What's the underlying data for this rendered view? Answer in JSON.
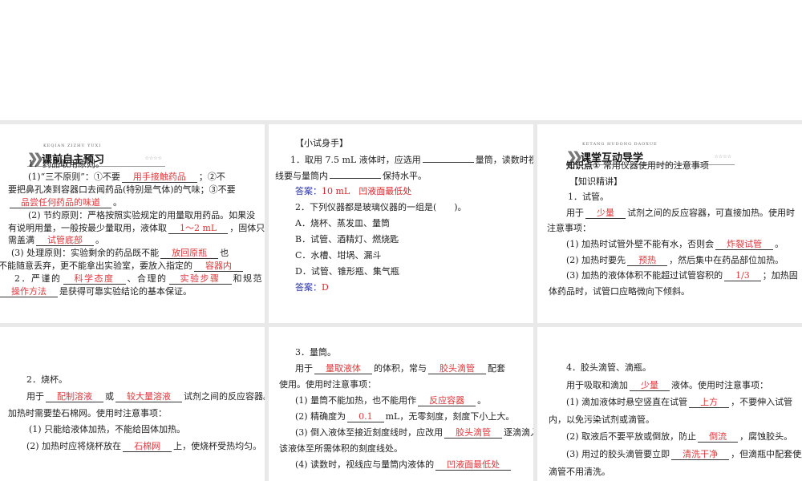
{
  "slides": [
    {
      "banner": {
        "pinyin": "KEQIAN ZIZHU YUXI",
        "title": "课前自主预习",
        "stars": "☆☆☆☆"
      },
      "lines": [
        [
          "1．药品取用原则。"
        ],
        [
          "(1)“三不原则”：①不要",
          {
            "a": "用手接触药品"
          },
          "；②不"
        ],
        [
          "要把鼻孔凑到容器口去闻药品(特别是气体)的气味；③不要"
        ],
        [
          {
            "a": "品尝任何药品的味道"
          },
          "。"
        ],
        [
          "(2) 节约原则：严格按照实验规定的用量取用药品。如果没"
        ],
        [
          "有说明用量，一般按最少量取用，液体取",
          {
            "a": "1～2 mL"
          },
          "，固体只"
        ],
        [
          "需盖满",
          {
            "a": "试管底部"
          },
          "。"
        ],
        [
          "(3) 处理原则：实验剩余的药品既不能",
          {
            "a": "放回原瓶"
          },
          "也"
        ],
        [
          "不能随意丢弃，更不能拿出实验室，要放入指定的",
          {
            "a": "容器内"
          }
        ],
        [
          "2．严谨的",
          {
            "a": "科学态度"
          },
          "、合理的",
          {
            "a": "实验步骤"
          },
          "和规范"
        ],
        [
          {
            "a": "操作方法"
          },
          "是获得可靠实验结论的基本保证。"
        ]
      ]
    },
    {
      "lines": [
        [
          "【小试身手】"
        ],
        [
          "1．取用 7.5 mL 液体时，应选用",
          {
            "b": ""
          },
          "量筒，读数时视"
        ],
        [
          "线要与量筒内",
          {
            "b": ""
          },
          "保持水平。"
        ],
        [
          {
            "l": "答案："
          },
          {
            "r": "10 mL　凹液面最低处"
          }
        ],
        [
          "2．下列仪器都是玻璃仪器的一组是(　　)。"
        ],
        [
          "A．烧杯、蒸发皿、量筒"
        ],
        [
          "B．试管、酒精灯、燃烧匙"
        ],
        [
          "C．水槽、坩埚、漏斗"
        ],
        [
          "D．试管、锥形瓶、集气瓶"
        ],
        [
          {
            "l": "答案："
          },
          {
            "r": "D"
          }
        ]
      ]
    },
    {
      "banner": {
        "pinyin": "KETANG HUDONG DAOXUE",
        "title": "课堂互动导学",
        "stars": "☆☆☆☆"
      },
      "lines": [
        [
          {
            "k": "知识点①"
          },
          " 常用仪器使用时的注意事项"
        ],
        [
          "【知识精讲】"
        ],
        [
          "1．试管。"
        ],
        [
          "用于",
          {
            "a": "少量"
          },
          "试剂之间的反应容器，可直接加热。使用时"
        ],
        [
          "注意事项："
        ],
        [
          "(1) 加热时试管外壁不能有水，否则会",
          {
            "a": "炸裂试管"
          },
          "。"
        ],
        [
          "(2) 加热时要先",
          {
            "a": "预热"
          },
          "，然后集中在药品部位加热。"
        ],
        [
          "(3) 加热的液体体积不能超过试管容积的",
          {
            "a": "1/3"
          },
          "；加热固"
        ],
        [
          "体药品时，试管口应略微向下倾斜。"
        ]
      ]
    },
    {
      "lines": [
        [
          "2．烧杯。"
        ],
        [
          "用于",
          {
            "a": "配制溶液"
          },
          "或",
          {
            "a": "较大量溶液"
          },
          "试剂之间的反应容器。"
        ],
        [
          "加热时需要垫石棉网。使用时注意事项："
        ],
        [
          "(1) 只能给液体加热，不能给固体加热。"
        ],
        [
          "(2) 加热时应将烧杯放在",
          {
            "a": "石棉网"
          },
          "上，使烧杯受热均匀。"
        ]
      ]
    },
    {
      "lines": [
        [
          "3．量筒。"
        ],
        [
          "用于",
          {
            "a": "量取液体"
          },
          "的体积，常与",
          {
            "a": "胶头滴管"
          },
          "配套"
        ],
        [
          "使用。使用时注意事项："
        ],
        [
          "(1) 量筒不能加热，也不能用作",
          {
            "a": "反应容器"
          },
          "。"
        ],
        [
          "(2) 精确度为",
          {
            "a": "0.1"
          },
          "mL，无零刻度，刻度下小上大。"
        ],
        [
          "(3) 倒入液体至接近刻度线时，应改用",
          {
            "a": "胶头滴管"
          },
          "逐滴滴入"
        ],
        [
          "该液体至所需体积的刻度线处。"
        ],
        [
          "(4) 读数时，视线应与量筒内液体的",
          {
            "a": "凹液面最低处"
          }
        ]
      ]
    },
    {
      "lines": [
        [
          "4．胶头滴管、滴瓶。"
        ],
        [
          "用于吸取和滴加",
          {
            "a": "少量"
          },
          "液体。使用时注意事项："
        ],
        [
          "(1) 滴加液体时悬空竖直在试管",
          {
            "a": "上方"
          },
          "，不要伸入试管"
        ],
        [
          "内，以免污染试剂或滴管。"
        ],
        [
          "(2) 取液后不要平放或倒放，防止",
          {
            "a": "倒流"
          },
          "，腐蚀胶头。"
        ],
        [
          "(3) 用过的胶头滴管要立即",
          {
            "a": "清洗干净"
          },
          "，但滴瓶中配套使用的"
        ],
        [
          "滴管不用清洗。"
        ]
      ]
    }
  ]
}
